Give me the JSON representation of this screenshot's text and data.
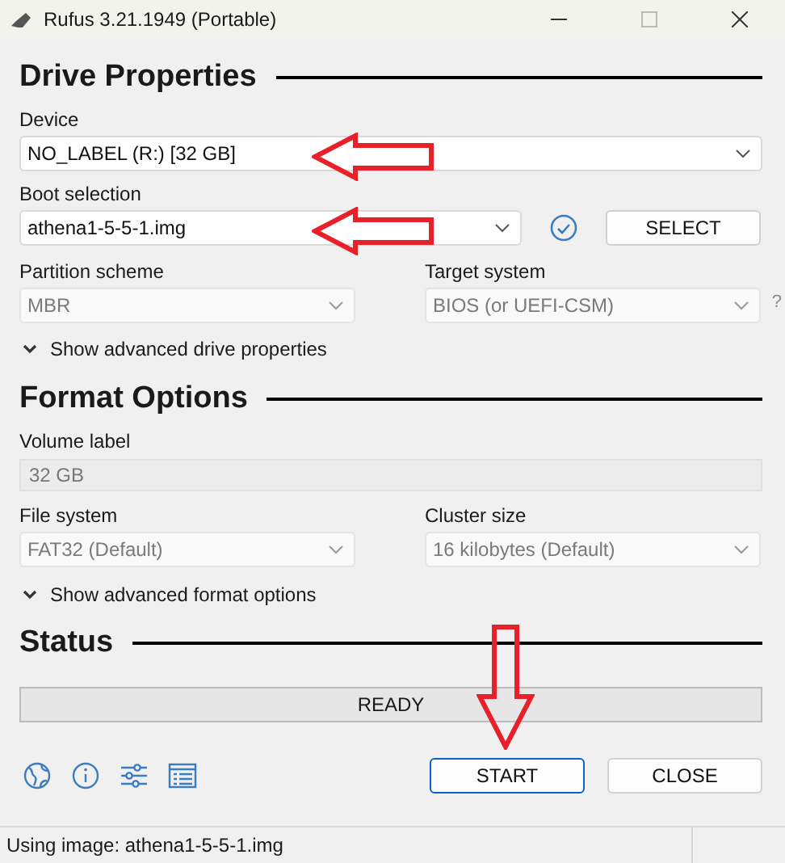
{
  "window": {
    "title": "Rufus 3.21.1949 (Portable)"
  },
  "drive_properties": {
    "heading": "Drive Properties",
    "device": {
      "label": "Device",
      "value": "NO_LABEL (R:) [32 GB]",
      "disabled": false
    },
    "boot_selection": {
      "label": "Boot selection",
      "value": "athena1-5-5-1.img",
      "disabled": false,
      "verified": true,
      "button": "SELECT"
    },
    "partition_scheme": {
      "label": "Partition scheme",
      "value": "MBR",
      "disabled": true
    },
    "target_system": {
      "label": "Target system",
      "value": "BIOS (or UEFI-CSM)",
      "disabled": true,
      "help": "?"
    },
    "advanced": {
      "label": "Show advanced drive properties",
      "expanded": false
    }
  },
  "format_options": {
    "heading": "Format Options",
    "volume_label": {
      "label": "Volume label",
      "value": "32 GB",
      "disabled": true
    },
    "file_system": {
      "label": "File system",
      "value": "FAT32 (Default)",
      "disabled": true
    },
    "cluster_size": {
      "label": "Cluster size",
      "value": "16 kilobytes (Default)",
      "disabled": true
    },
    "advanced": {
      "label": "Show advanced format options",
      "expanded": false
    }
  },
  "status": {
    "heading": "Status",
    "progress": {
      "text": "READY"
    }
  },
  "buttons": [
    {
      "label": "START",
      "selected": true
    },
    {
      "label": "CLOSE",
      "selected": false
    }
  ],
  "status_bar": {
    "text": "Using image: athena1-5-5-1.img"
  }
}
